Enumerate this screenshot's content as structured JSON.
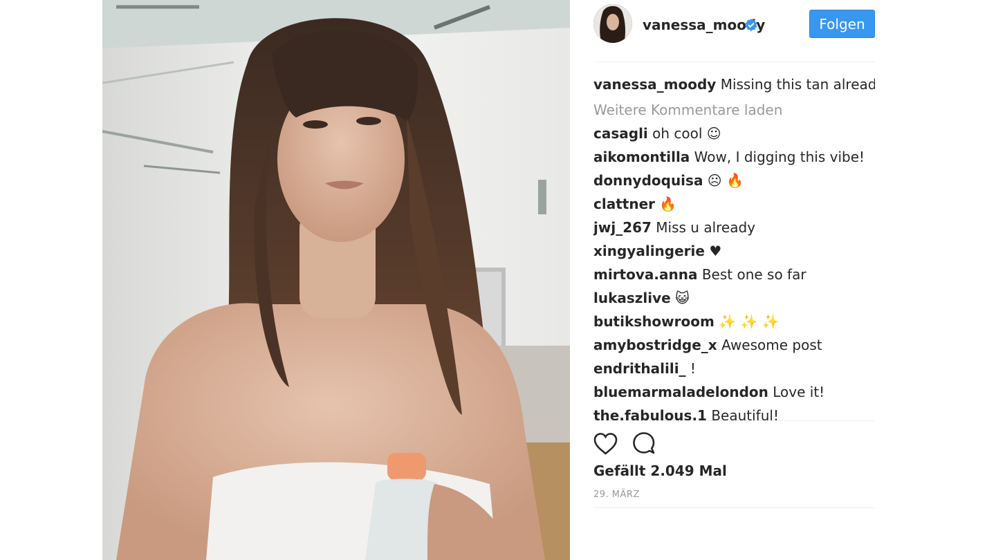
{
  "post": {
    "owner": "vanessa_moody",
    "follow_label": "Folgen",
    "caption_user": "vanessa_moody",
    "caption_text": "Missing this tan already",
    "load_more": "Weitere Kommentare laden",
    "comments": [
      {
        "user": "casagli",
        "text": "oh cool",
        "emoji": "☺"
      },
      {
        "user": "aikomontilla",
        "text": "Wow, I digging this vibe!",
        "emoji": ""
      },
      {
        "user": "donnydoquisa",
        "text": "",
        "emoji": "☹ 🔥"
      },
      {
        "user": "clattner",
        "text": "",
        "emoji": "🔥"
      },
      {
        "user": "jwj_267",
        "text": "Miss u already",
        "emoji": ""
      },
      {
        "user": "xingyalingerie",
        "text": "",
        "emoji": "♥"
      },
      {
        "user": "mirtova.anna",
        "text": "Best one so far",
        "emoji": ""
      },
      {
        "user": "lukaszlive",
        "text": "",
        "emoji": "😺"
      },
      {
        "user": "butikshowroom",
        "text": "",
        "emoji": "✨ ✨ ✨"
      },
      {
        "user": "amybostridge_x",
        "text": "Awesome post",
        "emoji": ""
      },
      {
        "user": "endrithalili_",
        "text": "!",
        "emoji": ""
      },
      {
        "user": "bluemarmaladelondon",
        "text": "Love it!",
        "emoji": ""
      },
      {
        "user": "the.fabulous.1",
        "text": "Beautiful!",
        "emoji": ""
      }
    ],
    "likes_text": "Gefällt 2.049 Mal",
    "date": "29. MÄRZ"
  },
  "icons": {
    "verified": "verified-badge-icon",
    "like": "heart-icon",
    "comment": "comment-bubble-icon"
  },
  "colors": {
    "follow_button": "#3897f0",
    "muted_text": "#999999",
    "text": "#262626",
    "verified": "#3897f0"
  }
}
